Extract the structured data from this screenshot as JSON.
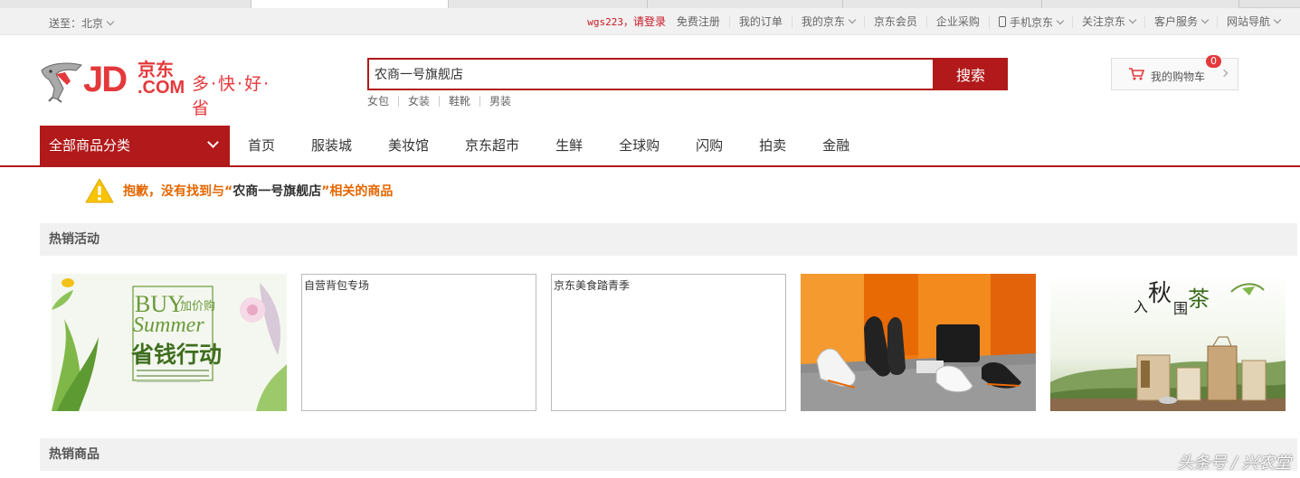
{
  "topbar": {
    "location": "送至：北京",
    "user": "wgs223，",
    "login": "请登录",
    "links": [
      "免费注册",
      "我的订单",
      "我的京东",
      "京东会员",
      "企业采购",
      "手机京东",
      "关注京东",
      "客户服务",
      "网站导航"
    ]
  },
  "logo": {
    "jd": "JD",
    "cn": "京东",
    "com": ".COM",
    "slogan": "多·快·好·省"
  },
  "search": {
    "value": "农商一号旗舰店",
    "button": "搜索",
    "hotwords": [
      "女包",
      "女装",
      "鞋靴",
      "男装"
    ]
  },
  "cart": {
    "label": "我的购物车",
    "count": "0"
  },
  "nav": {
    "all_categories": "全部商品分类",
    "links": [
      "首页",
      "服装城",
      "美妆馆",
      "京东超市",
      "生鲜",
      "全球购",
      "闪购",
      "拍卖",
      "金融"
    ]
  },
  "notice": {
    "part1": "抱歉，没有找到与“",
    "keyword": "农商一号旗舰店",
    "part2": "”相关的商品"
  },
  "sections": {
    "hot_activities": "热销活动",
    "hot_products": "热销商品"
  },
  "banners": {
    "summer": {
      "buy": "BUY",
      "jia": "加价购",
      "summer": "Summer",
      "main": "省钱行动"
    },
    "bags": "自营背包专场",
    "food": "京东美食踏青季",
    "tea": {
      "a": "入",
      "b": "秋",
      "c": "围",
      "d": "茶"
    }
  },
  "watermark": "头条号 / 兴农堂",
  "colors": {
    "brand_red": "#e4393c",
    "dark_red": "#b1191a",
    "warning_orange": "#e56600"
  }
}
